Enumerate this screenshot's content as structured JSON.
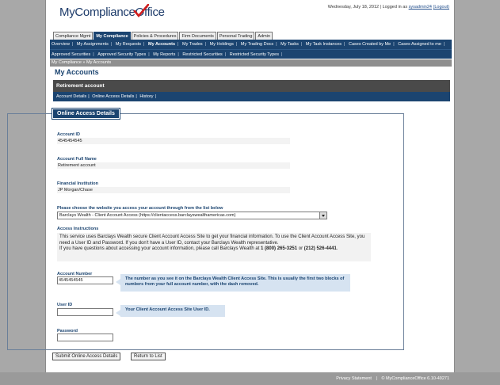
{
  "logo": {
    "text": "MyComplianceOffice"
  },
  "header": {
    "date": "Wednesday, July 18, 2012",
    "logged_in_as": "| Logged in as",
    "user": "sysadmin24",
    "logout": "(Logout)"
  },
  "tabs": [
    "Compliance Mgmt",
    "My Compliance",
    "Policies & Procedures",
    "Firm Documents",
    "Personal Trading",
    "Admin"
  ],
  "nav1": [
    "Overview",
    "My Assignments",
    "My Requests",
    "My Accounts",
    "My Trades",
    "My Holdings",
    "My Trading Docs",
    "My Tasks",
    "My Task Instances",
    "Cases Created by Me",
    "Cases Assigned to me"
  ],
  "nav2": [
    "Approved Securities",
    "Approved Security Types",
    "My Reports",
    "Restricted Securities",
    "Restricted Security Types"
  ],
  "breadcrumb": "My Compliance »  My Accounts",
  "page_title": "My Accounts",
  "account_bar": "Retirement account",
  "sub_nav": [
    "Account Details",
    "Online Access Details",
    "History"
  ],
  "section_title": "Online Access Details",
  "fields": {
    "account_id_label": "Account ID",
    "account_id": "4545454545",
    "account_full_name_label": "Account Full Name",
    "account_full_name": "Retirement account",
    "financial_institution_label": "Financial Institution",
    "financial_institution": "JP Morgan/Chase",
    "website_label": "Please choose the website you access your account through from the list below",
    "website_selected": "Barclays Wealth - Client Account Access (https://clientaccess.barclayswealthamericas.com)",
    "access_instructions_label": "Access Instructions",
    "instructions_p1": "This service uses Barclays Wealth secure Client Account Access Site to get your financial information. To use the Client Account Access Site, you need a User ID and Password. If you don't have a User ID, contact your Barclays Wealth representative.",
    "instructions_p2": "If you have questions about accessing your account information, please call Barclays Wealth at",
    "phone1": "1 (800) 265-3251",
    "or": "or",
    "phone2": "(212) 526-4441",
    "period": ".",
    "account_number_label": "Account Number",
    "account_number": "4545454545",
    "account_number_tip": "The number as you see it on the Barclays Wealth Client Access Site. This is usually the first two blocks of numbers from your full account number, with the dash removed.",
    "user_id_label": "User ID",
    "user_id": "",
    "user_id_tip": "Your Client Account Access Site User ID.",
    "password_label": "Password",
    "password": ""
  },
  "buttons": {
    "submit": "Submit Online Access Details",
    "return": "Return to List"
  },
  "footer": {
    "privacy": "Privacy Statement",
    "sep": "|",
    "copyright": "© MyComplianceOffice 6.10-49271"
  },
  "colors": {
    "navy": "#1b4470",
    "gray_bar": "#4a4a4a",
    "tip_bg": "#d6e3f1",
    "checkmark": "#d11f1f"
  },
  "icons": {
    "logo_check": "checkmark-icon",
    "dropdown": "chevron-down-icon"
  }
}
